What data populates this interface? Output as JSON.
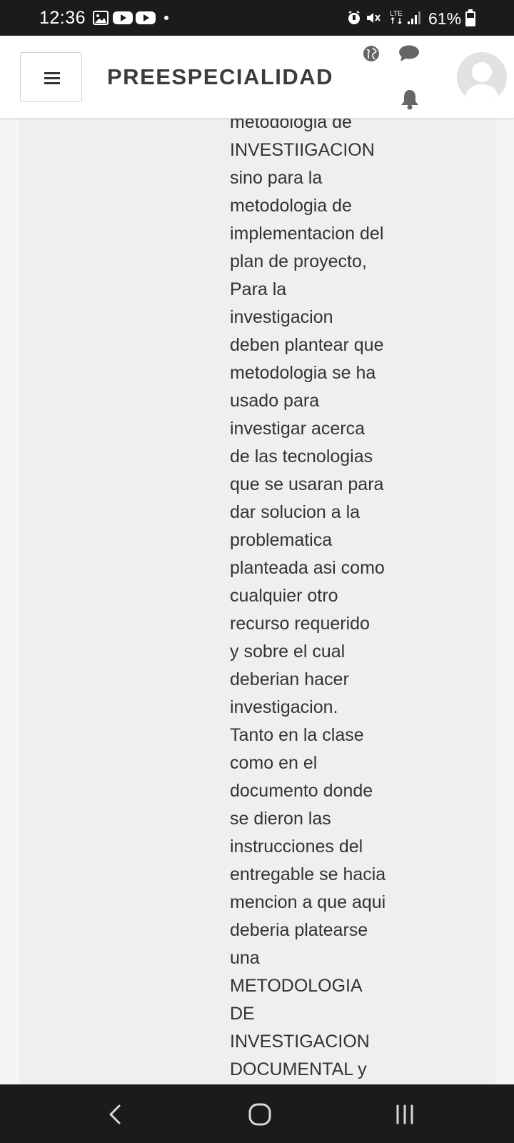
{
  "status_bar": {
    "time": "12:36",
    "battery_percent": "61%",
    "network_type": "LTE",
    "notification_icons": [
      "gallery-icon",
      "youtube-icon",
      "youtube-icon"
    ],
    "system_icons": [
      "alarm-icon",
      "mute-icon",
      "signal-icon",
      "battery-icon"
    ]
  },
  "header": {
    "site_title": "PREESPECIALIDAD",
    "menu_icon": "hamburger-menu-icon",
    "icons": [
      "language-globe-icon",
      "messages-icon",
      "notifications-bell-icon"
    ],
    "avatar": "user-avatar"
  },
  "post": {
    "lines": [
      "metodologia de",
      "INVESTIIGACION",
      "sino para la",
      "metodologia de",
      "implementacion del",
      "plan de proyecto,",
      "Para la",
      "investigacion",
      "deben plantear que",
      "metodologia se ha",
      "usado para",
      "investigar acerca",
      "de las tecnologias",
      "que se usaran para",
      "dar solucion a la",
      "problematica",
      "planteada asi como",
      "cualquier otro",
      "recurso requerido",
      "y sobre el cual",
      "deberian hacer",
      "investigacion.",
      "Tanto en la clase",
      "como en el",
      "documento donde",
      "se dieron las",
      "instrucciones del",
      "entregable se hacia",
      "mencion a que aqui",
      "deberia platearse",
      "una",
      "METODOLOGIA",
      "DE",
      "INVESTIGACION",
      "DOCUMENTAL y"
    ]
  },
  "nav_bar": {
    "buttons": [
      "back-icon",
      "home-icon",
      "recents-icon"
    ]
  },
  "colors": {
    "status_bar_bg": "#1b1b1b",
    "header_bg": "#ffffff",
    "title_text": "#3c3c3c",
    "body_text": "#333333",
    "content_bg": "#efefef",
    "icon_gray": "#666666"
  }
}
